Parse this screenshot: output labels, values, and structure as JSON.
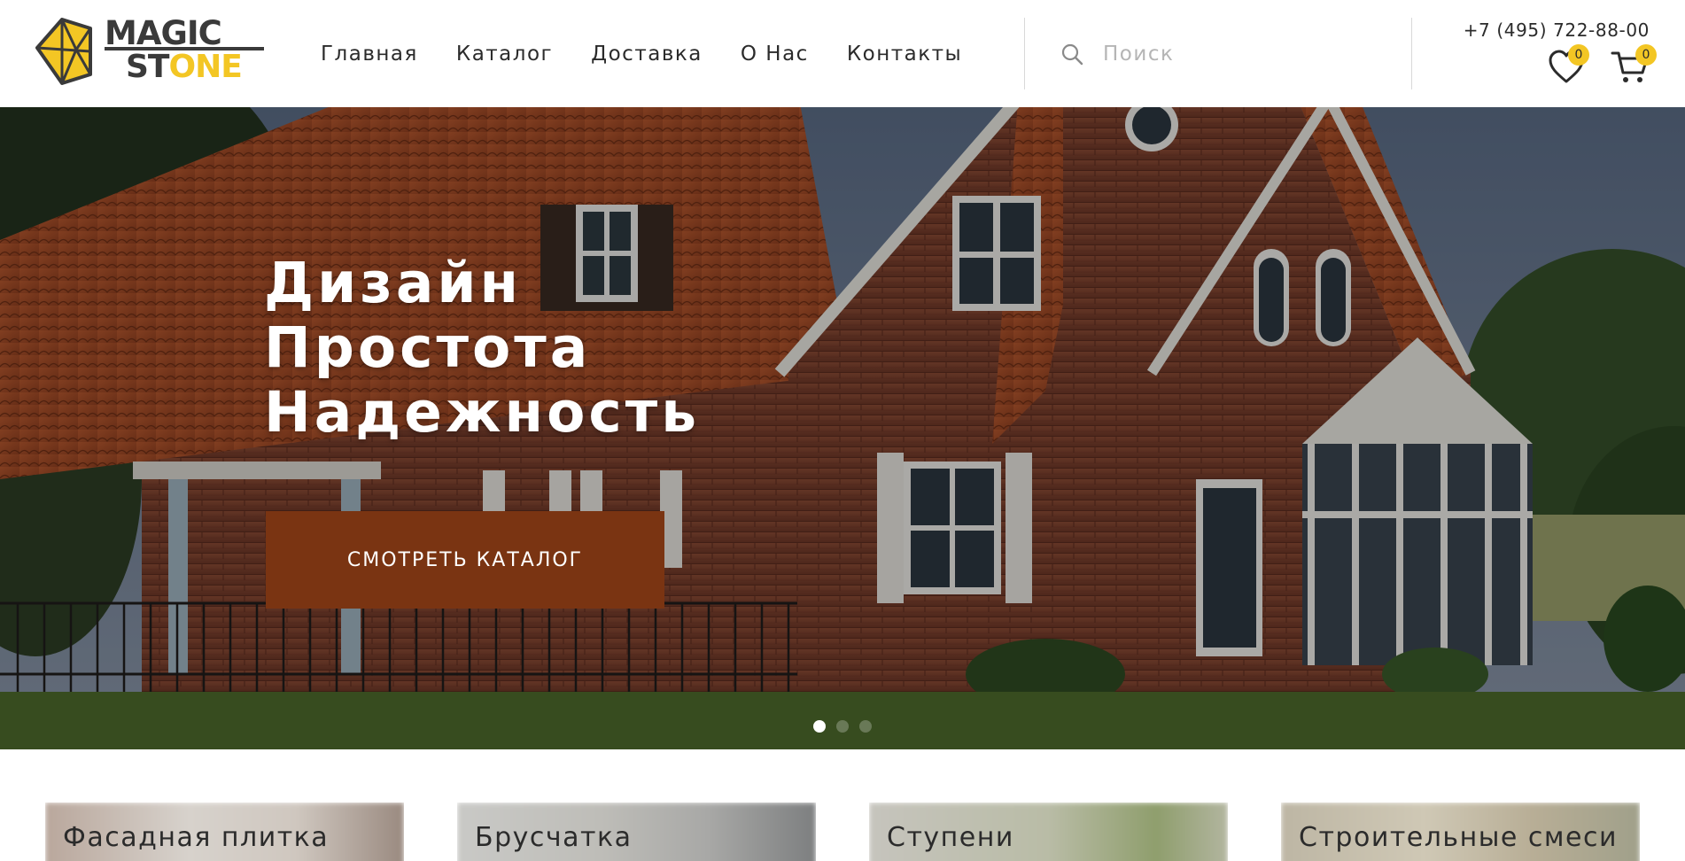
{
  "brand": {
    "line1": "MAGIC",
    "line2_dark": "ST",
    "line2_accent": "ONE",
    "accent_color": "#f3c624",
    "dark_color": "#3a3a3a"
  },
  "nav": {
    "items": [
      {
        "label": "Главная"
      },
      {
        "label": "Каталог"
      },
      {
        "label": "Доставка"
      },
      {
        "label": "О Нас"
      },
      {
        "label": "Контакты"
      }
    ]
  },
  "search": {
    "placeholder": "Поиск",
    "icon": "search-icon"
  },
  "contact": {
    "phone": "+7 (495) 722-88-00"
  },
  "favorites": {
    "icon": "heart-icon",
    "count": "0"
  },
  "cart": {
    "icon": "cart-icon",
    "count": "0"
  },
  "hero": {
    "title_lines": [
      "Дизайн",
      "Простота",
      "Надежность"
    ],
    "cta_label": "СМОТРЕТЬ КАТАЛОГ",
    "cta_color": "#7a3412",
    "slides_total": 3,
    "slide_active": 1
  },
  "categories": [
    {
      "label": "Фасадная плитка"
    },
    {
      "label": "Брусчатка"
    },
    {
      "label": "Ступени"
    },
    {
      "label": "Строительные смеси"
    }
  ]
}
